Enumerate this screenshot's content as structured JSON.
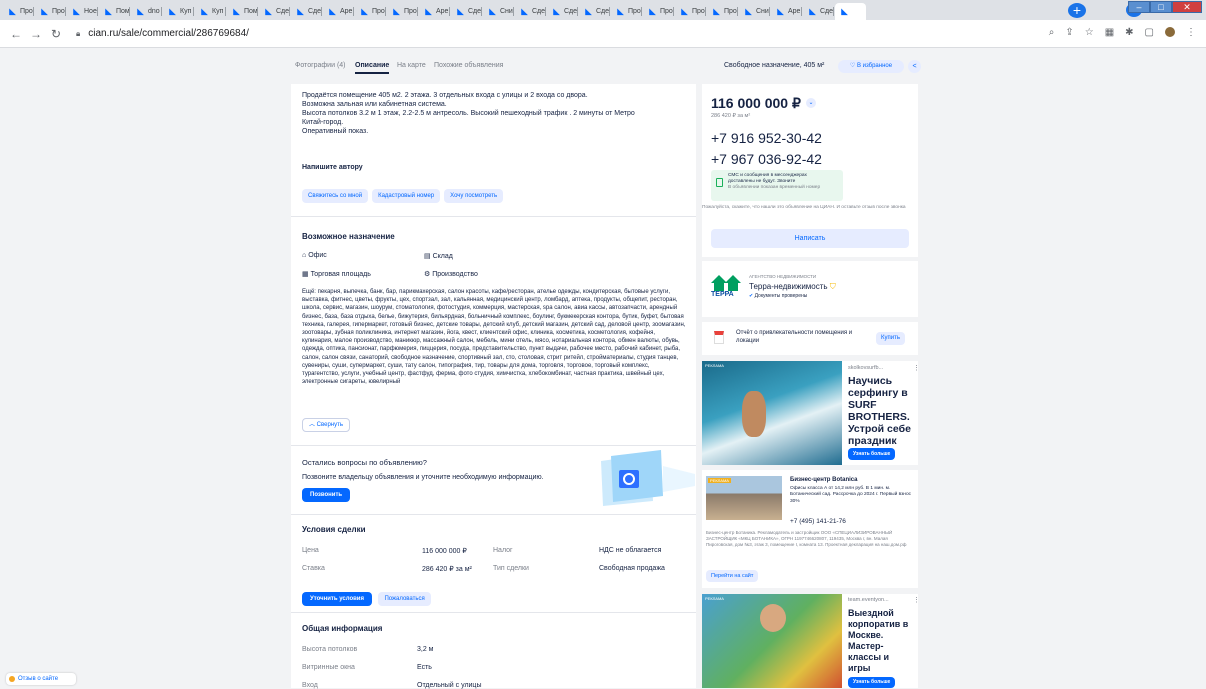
{
  "browser": {
    "tabs": [
      "Про",
      "Про",
      "Ное",
      "Пом",
      "dno",
      "Куп",
      "Куп",
      "Пом",
      "Сде",
      "Сде",
      "Аре",
      "Про",
      "Про",
      "Аре",
      "Сде",
      "Сни",
      "Сде",
      "Сде",
      "Сде",
      "Про",
      "Про",
      "Про",
      "Про",
      "Сни",
      "Аре",
      "Сде",
      ""
    ],
    "url": "cian.ru/sale/commercial/286769684/",
    "new_tab": "+"
  },
  "subnav": {
    "photos": "Фотографии (4)",
    "description": "Описание",
    "on_map": "На карте",
    "similar": "Похожие объявления",
    "purpose_area": "Свободное назначение, 405 м²",
    "favorite": "♡ В избранное",
    "share": "<"
  },
  "description": {
    "lines": [
      "Продаётся помещение 405 м2. 2 этажа. 3 отдельных входа с улицы и 2 входа со двора.",
      "Возможна зальная или кабинетная система.",
      "Высота потолков 3.2 м 1 этаж, 2.2-2.5 м антресоль. Высокий пешеходный трафик . 2 минуты от Метро",
      "Китай-город.",
      "Оперативный показ."
    ],
    "write_author": "Напишите автору",
    "quick_buttons": [
      "Свяжитесь со мной",
      "Кадастровый номер",
      "Хочу посмотреть"
    ]
  },
  "purpose": {
    "title": "Возможное назначение",
    "items": [
      {
        "icon": "office-icon",
        "label": "Офис"
      },
      {
        "icon": "warehouse-icon",
        "label": "Склад"
      },
      {
        "icon": "retail-icon",
        "label": "Торговая площадь"
      },
      {
        "icon": "production-icon",
        "label": "Производство"
      }
    ],
    "more_text": "Ещё: пекарня, выпечка, банк, бар, парикмахерская, салон красоты, кафе/ресторан, ателье одежды, кондитерская, бытовые услуги, выставка, фитнес, цветы, фрукты, цех, спортзал, зал, кальянная, медицинский центр, ломбард, аптека, продукты, общепит, ресторан, школа, сервис, магазин, шоурум, стоматология, фотостудия, коммерция, мастерская, spa салон, авиа кассы, автозапчасти, арендный бизнес, база, база отдыха, белье, бижутерия, бильярдная, больничный комплекс, боулинг, букмекерская контора, бутик, буфет, бытовая техника, галерея, гипермаркет, готовый бизнес, детские товары, детский клуб, детский магазин, детский сад, деловой центр, зоомагазин, зоотовары, зубная поликлиника, интернет магазин, йога, квест, клиентский офис, клиника, косметика, косметология, кофейня, кулинария, малое производство, маникюр, массажный салон, мебель, мини отель, мясо, нотариальная контора, обмен валюты, обувь, одежда, оптика, пансионат, парфюмерия, пиццерия, посуда, представительство, пункт выдачи, рабочее место, рабочий кабинет, рыба, салон, салон связи, санаторий, свободное назначение, спортивный зал, сто, столовая, стрит ритейл, стройматериалы, студия танцев, сувениры, суши, супермаркет, суши, тату салон, типография, тир, товары для дома, торговля, торговое, торговый комплекс, турагентство, услуги, учебный центр, фастфуд, ферма, фото студия, химчистка, хлебокомбинат, частная практика, швейный цех, электронные сигареты, ювелирный",
    "collapse": "Свернуть"
  },
  "questions": {
    "title": "Остались вопросы по объявлению?",
    "text": "Позвоните владельцу объявления и уточните необходимую информацию.",
    "call": "Позвонить"
  },
  "deal": {
    "title": "Условия сделки",
    "rows": [
      {
        "k1": "Цена",
        "v1": "116 000 000 ₽",
        "k2": "Налог",
        "v2": "НДС не облагается"
      },
      {
        "k1": "Ставка",
        "v1": "286 420 ₽ за м²",
        "k2": "Тип сделки",
        "v2": "Свободная продажа"
      }
    ],
    "clarify": "Уточнить условия",
    "complain": "Пожаловаться"
  },
  "general": {
    "title": "Общая информация",
    "rows": [
      {
        "k": "Высота потолков",
        "v": "3,2 м"
      },
      {
        "k": "Витринные окна",
        "v": "Есть"
      },
      {
        "k": "Вход",
        "v": "Отдельный с улицы"
      }
    ]
  },
  "price_card": {
    "price": "116 000 000 ₽",
    "per_m2": "286 420 ₽ за м²",
    "phone1": "+7 916 952-30-42",
    "phone2": "+7 967 036-92-42",
    "sms_line1": "СМС и сообщения в мессенджерах",
    "sms_line2": "доставлены не будут. Звоните",
    "sms_line3": "В объявлении показан временный номер",
    "note": "Пожалуйста, скажите, что нашли это объявление на ЦИАН. И оставьте отзыв после звонка",
    "write": "Написать"
  },
  "agency": {
    "label": "АГЕНТСТВО НЕДВИЖИМОСТИ",
    "name": "Терра-недвижимость",
    "verified": "Документы проверены",
    "logo": "ТЕРРА"
  },
  "report": {
    "text": "Отчёт о привлекательности помещения и локации",
    "buy": "Купить"
  },
  "ad1": {
    "badge": "РЕКЛАМА",
    "source": "skolkovsurfb...",
    "title": "Научись серфингу в SURF BROTHERS. Устрой себе праздник",
    "cta": "Узнать больше"
  },
  "ad2": {
    "badge": "РЕКЛАМА",
    "title": "Бизнес-центр Botanica",
    "text": "Офисы класса А от 14,2 млн руб. В 1 мин. м. Ботанический сад. Рассрочка до 2024 г. Первый взнос 30%",
    "phone": "+7 (495) 141-21-76",
    "legal": "Бизнес-центр Ботаника. Рекламодатель и застройщик ООО «СПЕЦИАЛИЗИРОВАННЫЙ ЗАСТРОЙЩИК «МКЦ БОТАНИКА», ОГРН 1197746620807, 119435, Москва г, вн. Малая Пироговская, дом №3, этаж 3, помещение I, комната 13. Проектная декларация на наш.дом.рф",
    "cta": "Перейти на сайт"
  },
  "ad3": {
    "badge": "РЕКЛАМА",
    "source": "team.eventyon...",
    "title": "Выездной корпоратив в Москве. Мастер-классы и игры",
    "cta": "Узнать больше"
  },
  "footer": {
    "feedback": "Отзыв о сайте"
  }
}
